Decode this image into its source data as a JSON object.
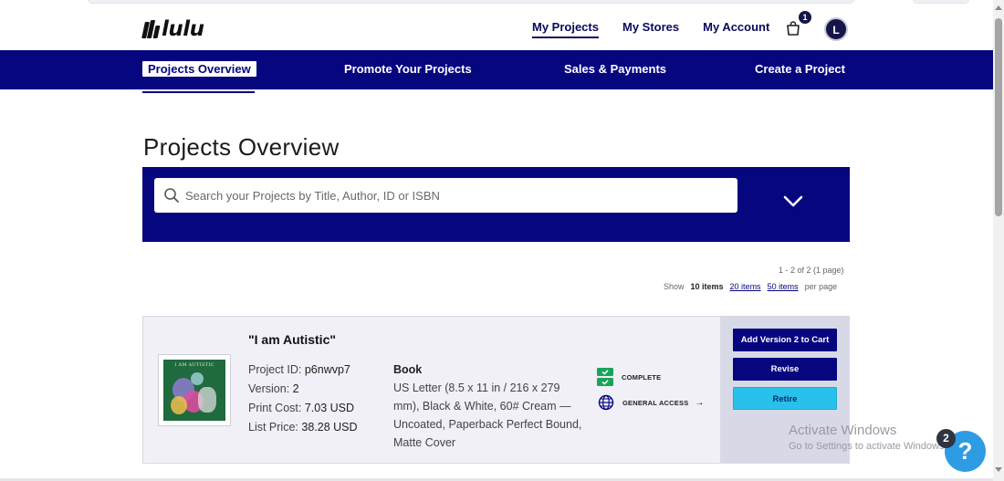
{
  "header": {
    "brand": "lulu",
    "nav": [
      {
        "label": "My Projects",
        "active": true
      },
      {
        "label": "My Stores",
        "active": false
      },
      {
        "label": "My Account",
        "active": false
      }
    ],
    "cart_icon": "shopping-bag-icon",
    "cart_count": "1",
    "avatar_initial": "L"
  },
  "subnav": {
    "items": [
      {
        "label": "Projects Overview",
        "active": true
      },
      {
        "label": "Promote Your Projects",
        "active": false
      },
      {
        "label": "Sales & Payments",
        "active": false
      },
      {
        "label": "Create a Project",
        "active": false
      }
    ]
  },
  "main": {
    "title": "Projects Overview",
    "search": {
      "placeholder": "Search your Projects by Title, Author, ID or ISBN",
      "value": ""
    },
    "pagination": {
      "summary": "1 - 2 of 2 (1 page)",
      "show_label": "Show",
      "current": "10 items",
      "options": [
        "20 items",
        "50 items"
      ],
      "suffix": "per page"
    }
  },
  "project": {
    "title": "\"I am Autistic\"",
    "cover_text": "I AM AUTISTIC",
    "id_label": "Project ID:",
    "id_value": "p6nwvp7",
    "version_label": "Version:",
    "version_value": "2",
    "print_cost_label": "Print Cost:",
    "print_cost_value": "7.03 USD",
    "list_price_label": "List Price:",
    "list_price_value": "38.28 USD",
    "format_type": "Book",
    "format_details": "US Letter (8.5 x 11 in / 216 x 279 mm), Black & White, 60# Cream — Uncoated, Paperback Perfect Bound, Matte Cover",
    "status_complete": "COMPLETE",
    "status_access": "GENERAL ACCESS",
    "actions": {
      "add_to_cart": "Add Version 2 to Cart",
      "revise": "Revise",
      "retire": "Retire"
    }
  },
  "overlay": {
    "watermark_title": "Activate Windows",
    "watermark_sub": "Go to Settings to activate Windows.",
    "help_label": "?",
    "help_badge": "2"
  },
  "colors": {
    "brand_navy": "#06067f",
    "retire_cyan": "#29c1ec",
    "complete_green": "#1aa35a",
    "help_blue": "#2d9ce2"
  }
}
